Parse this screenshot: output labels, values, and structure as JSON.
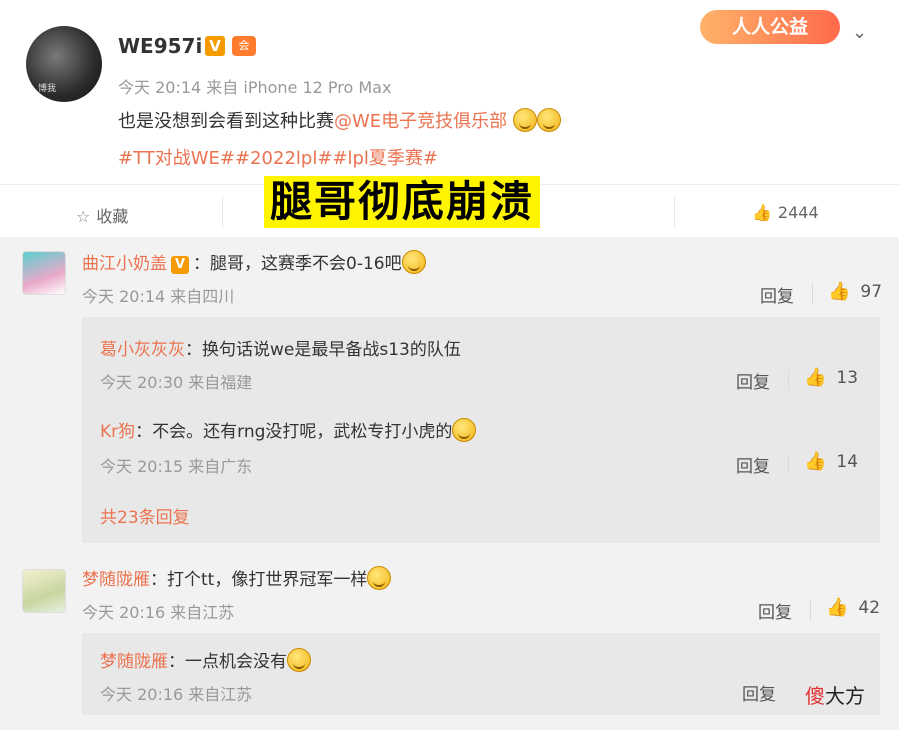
{
  "post": {
    "username": "WE957i",
    "verified_badge": "V",
    "vip_badge": "会",
    "avatar_caption": "博我",
    "meta": "今天 20:14 来自 iPhone 12 Pro Max",
    "text_before": "也是没想到会看到这种比赛",
    "mention": "@WE电子竞技俱乐部",
    "tags": "#TT对战WE##2022lpl##lpl夏季赛#",
    "charity_label": "人人公益",
    "chevron": "⌄",
    "actions": {
      "collect": "收藏",
      "likes": "2444"
    },
    "icons": {
      "collect": "☆",
      "like": "👍"
    }
  },
  "overlay_caption": "腿哥彻底崩溃",
  "comments": [
    {
      "nick": "曲江小奶盖",
      "badge": "V",
      "text": "：腿哥，这赛季不会0-16吧",
      "meta": "今天 20:14 来自四川",
      "reply_label": "回复",
      "likes": "97",
      "replies": [
        {
          "nick": "葛小灰灰灰",
          "text": "：换句话说we是最早备战s13的队伍",
          "meta": "今天 20:30 来自福建",
          "reply_label": "回复",
          "likes": "13"
        },
        {
          "nick": "Kr狗",
          "text": "：不会。还有rng没打呢，武松专打小虎的",
          "meta": "今天 20:15 来自广东",
          "reply_label": "回复",
          "likes": "14"
        }
      ],
      "more_replies": "共23条回复"
    },
    {
      "nick": "梦随陇雁",
      "text": "：打个tt，像打世界冠军一样",
      "meta": "今天 20:16 来自江苏",
      "reply_label": "回复",
      "likes": "42",
      "replies": [
        {
          "nick": "梦随陇雁",
          "text": "：一点机会没有",
          "meta": "今天 20:16 来自江苏",
          "reply_label": "回复"
        }
      ]
    }
  ],
  "watermark": {
    "red": "傻",
    "rest": "大方"
  }
}
